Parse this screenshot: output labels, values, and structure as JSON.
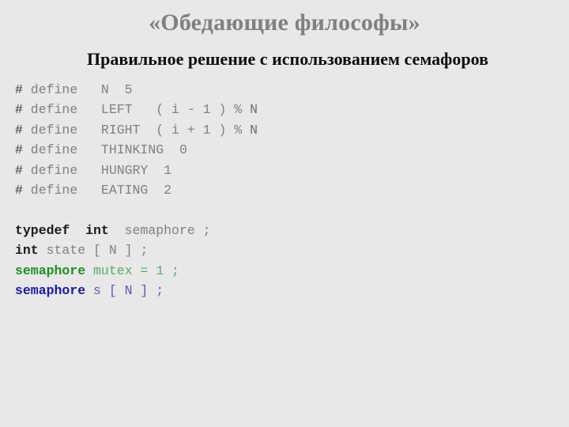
{
  "slide": {
    "title": "«Обедающие философы»",
    "subtitle": "Правильное решение с использованием семафоров",
    "background_color": "#e8e8e8",
    "title_color": "#808080",
    "subtitle_color": "#0d0d0d"
  },
  "code": {
    "language": "C",
    "colors": {
      "hash": "#3a3a3a",
      "grey": "#808080",
      "keyword": "#1a1a1a",
      "green": "#1d9023",
      "green_light": "#5aab63",
      "blue": "#1a1aa8",
      "blue_light": "#5a5ab4"
    },
    "lines": [
      {
        "id": "define-n",
        "tokens": [
          {
            "t": "#",
            "c": "hash"
          },
          {
            "t": " define",
            "c": "grey"
          },
          {
            "t": "   N  5",
            "c": "grey"
          }
        ]
      },
      {
        "id": "define-left",
        "tokens": [
          {
            "t": "#",
            "c": "hash"
          },
          {
            "t": " define",
            "c": "grey"
          },
          {
            "t": "   LEFT   ( i - 1 ) ",
            "c": "grey"
          },
          {
            "t": "%",
            "c": "grey"
          },
          {
            "t": " N",
            "c": "greydark"
          }
        ]
      },
      {
        "id": "define-right",
        "tokens": [
          {
            "t": "#",
            "c": "hash"
          },
          {
            "t": " define",
            "c": "grey"
          },
          {
            "t": "   RIGHT  ( i + 1 ) ",
            "c": "grey"
          },
          {
            "t": "%",
            "c": "grey"
          },
          {
            "t": " N",
            "c": "greydark"
          }
        ]
      },
      {
        "id": "define-thinking",
        "tokens": [
          {
            "t": "#",
            "c": "hash"
          },
          {
            "t": " define",
            "c": "grey"
          },
          {
            "t": "   THINKING  0",
            "c": "grey"
          }
        ]
      },
      {
        "id": "define-hungry",
        "tokens": [
          {
            "t": "#",
            "c": "hash"
          },
          {
            "t": " define",
            "c": "grey"
          },
          {
            "t": "   HUNGRY  1",
            "c": "grey"
          }
        ]
      },
      {
        "id": "define-eating",
        "tokens": [
          {
            "t": "#",
            "c": "hash"
          },
          {
            "t": " define",
            "c": "grey"
          },
          {
            "t": "   EATING  2",
            "c": "grey"
          }
        ]
      },
      {
        "id": "blank-1",
        "tokens": []
      },
      {
        "id": "typedef-semaphore",
        "tokens": [
          {
            "t": "typedef",
            "c": "keyword"
          },
          {
            "t": "  ",
            "c": "grey"
          },
          {
            "t": "int",
            "c": "keyword"
          },
          {
            "t": "  semaphore ;",
            "c": "grey"
          }
        ]
      },
      {
        "id": "state-array",
        "tokens": [
          {
            "t": "int",
            "c": "keyword"
          },
          {
            "t": " state [ N ] ;",
            "c": "grey"
          }
        ]
      },
      {
        "id": "mutex-decl",
        "tokens": [
          {
            "t": "semaphore",
            "c": "green"
          },
          {
            "t": " mutex = 1 ;",
            "c": "green_light"
          }
        ]
      },
      {
        "id": "s-array-decl",
        "tokens": [
          {
            "t": "semaphore",
            "c": "blue"
          },
          {
            "t": " s [ N ] ;",
            "c": "blue_light"
          }
        ]
      }
    ]
  }
}
